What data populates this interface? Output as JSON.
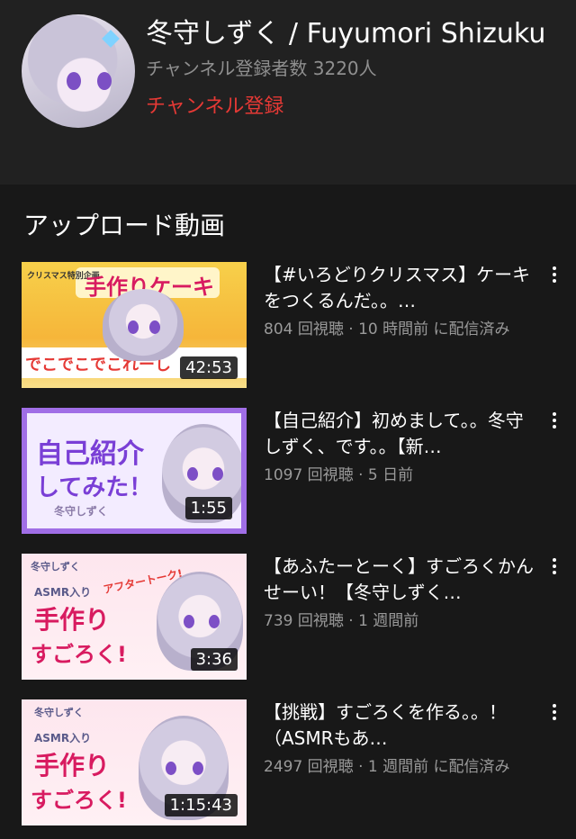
{
  "channel": {
    "name": "冬守しずく / Fuyumori Shizuku",
    "subscribers": "チャンネル登録者数 3220人",
    "subscribe_label": "チャンネル登録"
  },
  "section": {
    "title": "アップロード動画"
  },
  "videos": [
    {
      "title": "【#いろどりクリスマス】ケーキをつくるんだ。。…",
      "meta": "804 回視聴 · 10 時間前 に配信済み",
      "duration": "42:53",
      "thumb_text": [
        "クリスマス特別企画",
        "手作りケーキ",
        "でこでこでこれーし"
      ]
    },
    {
      "title": "【自己紹介】初めまして。。冬守しずく、です。。【新…",
      "meta": "1097 回視聴 · 5 日前",
      "duration": "1:55",
      "thumb_text": [
        "自己紹介",
        "してみた！",
        "冬守しずく"
      ]
    },
    {
      "title": "【あふたーとーく】すごろくかんせーい！【冬守しずく…",
      "meta": "739 回視聴 · 1 週間前",
      "duration": "3:36",
      "thumb_text": [
        "冬守しずく",
        "ASMR入り",
        "アフタートーク!",
        "手作り",
        "すごろく!"
      ]
    },
    {
      "title": "【挑戦】すごろくを作る。。！（ASMRもあ…",
      "meta": "2497 回視聴 · 1 週間前 に配信済み",
      "duration": "1:15:43",
      "thumb_text": [
        "冬守しずく",
        "ASMR入り",
        "手作り",
        "すごろく!"
      ]
    }
  ],
  "icons": {
    "more": "more-vert-icon"
  },
  "colors": {
    "background": "#212121",
    "list_background": "#181818",
    "subscribe": "#e53935",
    "meta": "#9a9a9a"
  }
}
